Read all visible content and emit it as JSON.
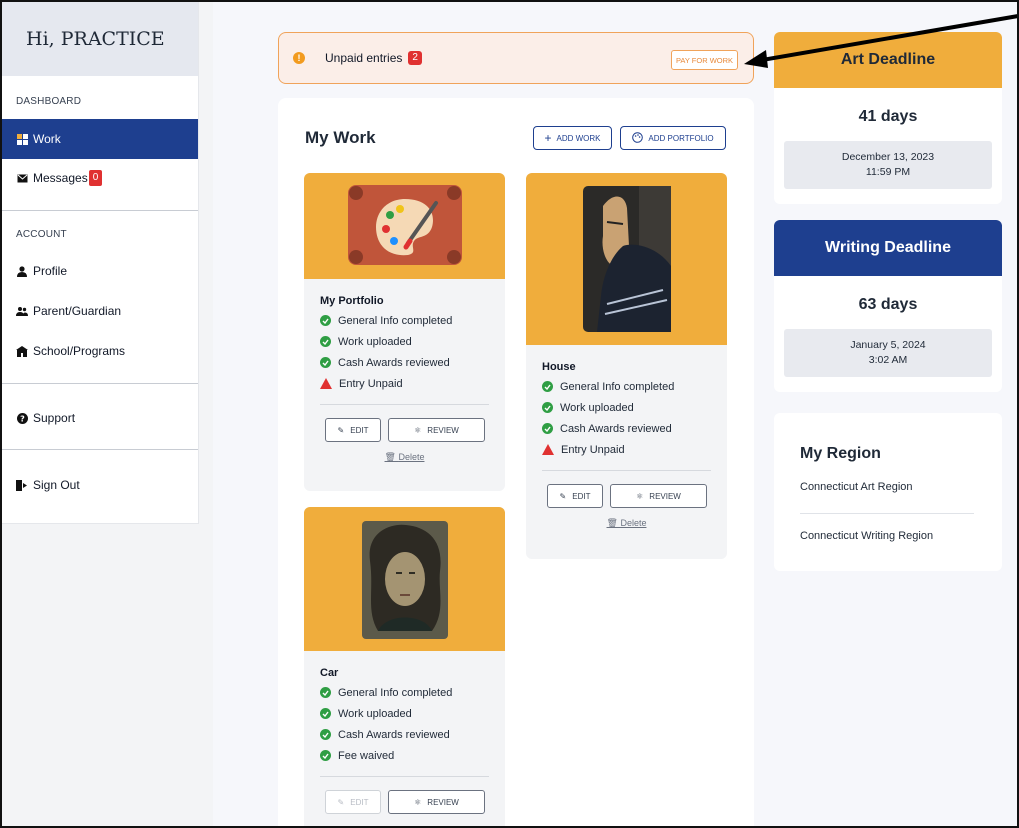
{
  "sidebar": {
    "greeting": "Hi, PRACTICE",
    "dashboard_label": "DASHBOARD",
    "work_label": "Work",
    "messages_label": "Messages",
    "messages_count": "0",
    "account_label": "ACCOUNT",
    "profile_label": "Profile",
    "parent_label": "Parent/Guardian",
    "school_label": "School/Programs",
    "support_label": "Support",
    "signout_label": "Sign Out"
  },
  "alert": {
    "text": "Unpaid entries",
    "count": "2",
    "pay_label": "PAY FOR WORK",
    "icon": "exclamation-icon"
  },
  "main": {
    "title": "My Work",
    "add_work_label": "ADD WORK",
    "add_portfolio_label": "ADD PORTFOLIO"
  },
  "cards": {
    "portfolio": {
      "title": "My Portfolio",
      "checks": [
        "General Info completed",
        "Work uploaded",
        "Cash Awards reviewed"
      ],
      "warning": "Entry Unpaid",
      "edit_label": "EDIT",
      "review_label": "REVIEW",
      "delete_label": "Delete"
    },
    "house": {
      "title": "House",
      "checks": [
        "General Info completed",
        "Work uploaded",
        "Cash Awards reviewed"
      ],
      "warning": "Entry Unpaid",
      "edit_label": "EDIT",
      "review_label": "REVIEW",
      "delete_label": "Delete"
    },
    "car": {
      "title": "Car",
      "checks": [
        "General Info completed",
        "Work uploaded",
        "Cash Awards reviewed",
        "Fee waived"
      ],
      "edit_label": "EDIT",
      "review_label": "REVIEW"
    }
  },
  "deadlines": {
    "art": {
      "title": "Art Deadline",
      "days": "41 days",
      "date": "December 13, 2023",
      "time": "11:59 PM",
      "color": "#f0ad3c"
    },
    "writing": {
      "title": "Writing Deadline",
      "days": "63 days",
      "date": "January 5, 2024",
      "time": "3:02 AM",
      "color": "#1e3f8f"
    }
  },
  "region": {
    "title": "My Region",
    "items": [
      "Connecticut Art Region",
      "Connecticut Writing Region"
    ]
  },
  "colors": {
    "accent_blue": "#1e3f8f",
    "accent_orange": "#f0ad3c",
    "success": "#2f9e44",
    "danger": "#e03131"
  }
}
